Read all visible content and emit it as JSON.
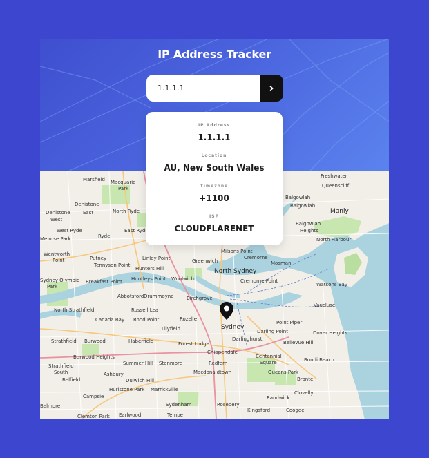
{
  "header": {
    "title": "IP Address Tracker"
  },
  "search": {
    "value": "1.1.1.1",
    "submit_icon": "chevron-right-icon"
  },
  "info": {
    "ip_label": "IP Address",
    "ip_value": "1.1.1.1",
    "location_label": "Location",
    "location_value": "AU, New South Wales",
    "timezone_label": "Timezone",
    "timezone_value": "+1100",
    "isp_label": "ISP",
    "isp_value": "CLOUDFLARENET"
  },
  "map": {
    "marker_icon": "location-pin-icon",
    "labels": {
      "marsfield": "Marsfield",
      "macquarie": "Macquarie",
      "park": "Park",
      "freshwater": "Freshwater",
      "queenscliff": "Queenscliff",
      "balgowlah": "Balgowlah",
      "balgowlah2": "Balgowlah",
      "manly": "Manly",
      "denistone": "Denistone",
      "denistone_e": "Denistone",
      "east": "East",
      "north_ryde": "North Ryde",
      "denistone_w": "Denistone",
      "west": "West",
      "west_ryde": "West Ryde",
      "ryde": "Ryde",
      "east_ryde": "East Ryde",
      "melrose_park": "Melrose Park",
      "balgowlah_h": "Balgowlah",
      "heights": "Heights",
      "north_harbour": "North Harbour",
      "wentworth": "Wentworth",
      "point": "Point",
      "putney": "Putney",
      "tennyson_point": "Tennyson Point",
      "linley_point": "Linley Point",
      "greenwich": "Greenwich",
      "cremorne": "Cremorne",
      "mosman": "Mosman",
      "milsons_point": "Milsons Point",
      "hunters_hill": "Hunters Hill",
      "north_sydney": "North Sydney",
      "sydney_olympic": "Sydney Olympic",
      "park2": "Park",
      "breakfast_point": "Breakfast Point",
      "huntleys_point": "Huntleys Point",
      "woolwich": "Woolwich",
      "cremorne_point": "Cremorne Point",
      "watsons_bay": "Watsons Bay",
      "abbotsford": "Abbotsford",
      "drummoyne": "Drummoyne",
      "birchgrove": "Birchgrove",
      "north_strathfield": "North Strathfield",
      "russell_lea": "Russell Lea",
      "vaucluse": "Vaucluse",
      "canada_bay": "Canada Bay",
      "rodd_point": "Rodd Point",
      "rozelle": "Rozelle",
      "lilyfield": "Lilyfield",
      "sydney": "Sydney",
      "point_piper": "Point Piper",
      "darling_point": "Darling Point",
      "dover_heights": "Dover Heights",
      "strathfield": "Strathfield",
      "burwood": "Burwood",
      "haberfield": "Haberfield",
      "forest_lodge": "Forest Lodge",
      "darlinghurst": "Darlinghurst",
      "bellevue_hill": "Bellevue Hill",
      "chippendale": "Chippendale",
      "centennial": "Centennial",
      "square": "Square",
      "bondi_beach": "Bondi Beach",
      "burwood_heights": "Burwood Heights",
      "summer_hill": "Summer Hill",
      "stanmore": "Stanmore",
      "redfern": "Redfern",
      "strathfield_s": "Strathfield",
      "south": "South",
      "ashbury": "Ashbury",
      "macdonaldtown": "Macdonaldtown",
      "queens_park": "Queens Park",
      "bronte": "Bronte",
      "belfield": "Belfield",
      "dulwich_hill": "Dulwich Hill",
      "campsie": "Campsie",
      "hurlstone_park": "Hurlstone Park",
      "marrickville": "Marrickville",
      "clovelly": "Clovelly",
      "randwick": "Randwick",
      "sydenham": "Sydenham",
      "rosebery": "Rosebery",
      "belmore": "Belmore",
      "kingsford": "Kingsford",
      "coogee": "Coogee",
      "clemton_park": "Clemton Park",
      "earlwood": "Earlwood",
      "tempe": "Tempe"
    }
  }
}
